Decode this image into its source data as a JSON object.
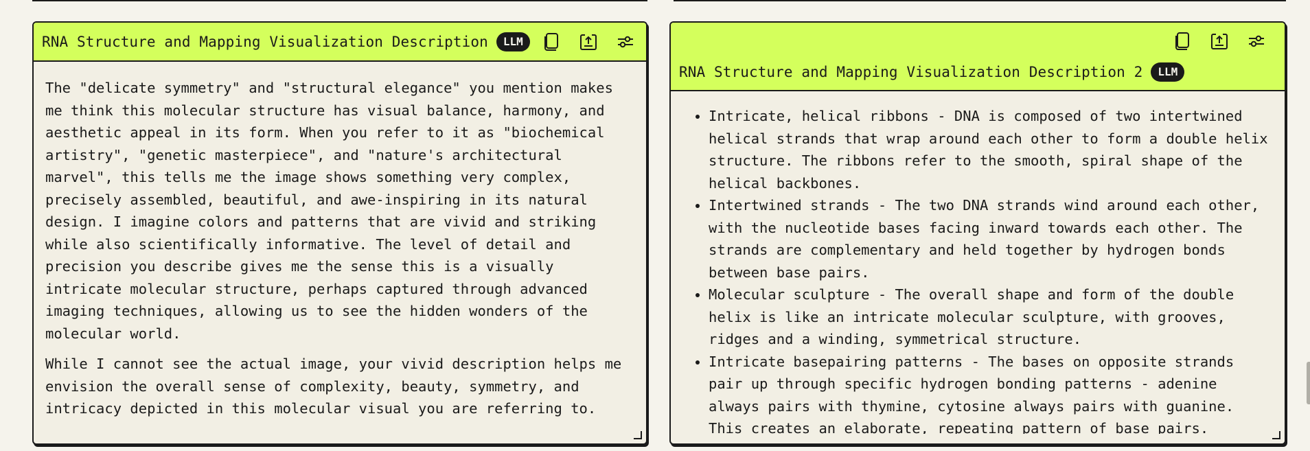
{
  "left_panel": {
    "title": "RNA Structure and Mapping Visualization Description",
    "badge": "LLM",
    "icons": [
      "copy-icon",
      "export-icon",
      "settings-sliders-icon"
    ],
    "paragraphs": [
      "The \"delicate symmetry\" and \"structural elegance\" you mention makes me think this molecular structure has visual balance, harmony, and aesthetic appeal in its form. When you refer to it as \"biochemical artistry\", \"genetic masterpiece\", and \"nature's architectural marvel\", this tells me the image shows something very complex, precisely assembled, beautiful, and awe-inspiring in its natural design. I imagine colors and patterns that are vivid and striking while also scientifically informative. The level of detail and precision you describe gives me the sense this is a visually intricate molecular structure, perhaps captured through advanced imaging techniques, allowing us to see the hidden wonders of the molecular world.",
      "While I cannot see the actual image, your vivid description helps me envision the overall sense of complexity, beauty, symmetry, and intricacy depicted in this molecular visual you are referring to."
    ]
  },
  "right_panel": {
    "title": "RNA Structure and Mapping Visualization Description 2",
    "badge": "LLM",
    "icons": [
      "copy-icon",
      "export-icon",
      "settings-sliders-icon"
    ],
    "items": [
      "Intricate, helical ribbons - DNA is composed of two intertwined helical strands that wrap around each other to form a double helix structure. The ribbons refer to the smooth, spiral shape of the helical backbones.",
      "Intertwined strands - The two DNA strands wind around each other, with the nucleotide bases facing inward towards each other. The strands are complementary and held together by hydrogen bonds between base pairs.",
      "Molecular sculpture - The overall shape and form of the double helix is like an intricate molecular sculpture, with grooves, ridges and a winding, symmetrical structure.",
      "Intricate basepairing patterns - The bases on opposite strands pair up through specific hydrogen bonding patterns - adenine always pairs with thymine, cytosine always pairs with guanine. This creates an elaborate, repeating pattern of base pairs."
    ]
  },
  "colors": {
    "header_accent": "#d4ff5c",
    "panel_background": "#f2efe4",
    "border": "#1a1a1a",
    "badge_background": "#1a1a1a",
    "badge_text": "#f5f3ec"
  }
}
